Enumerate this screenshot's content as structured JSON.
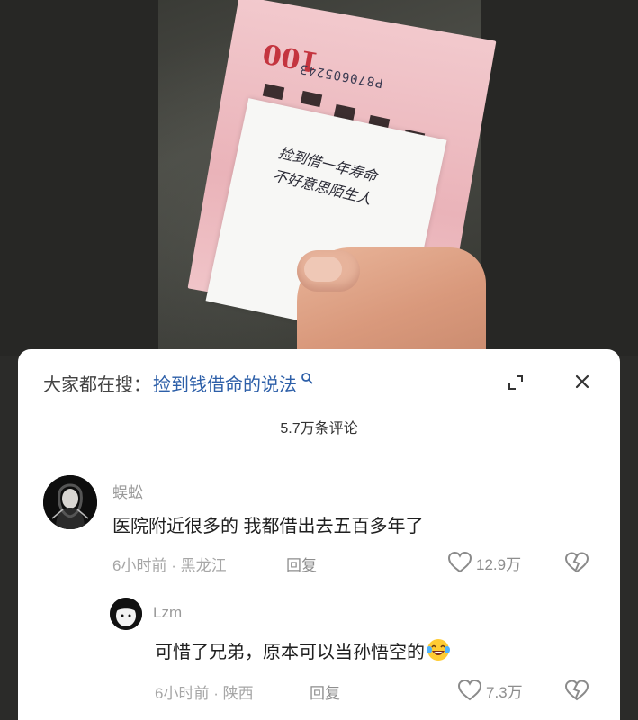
{
  "photo": {
    "serial": "P870605243",
    "denomination": "100",
    "note_line1": "捡到借一年寿命",
    "note_line2": "不好意思陌生人"
  },
  "search": {
    "prefix": "大家都在搜：",
    "query": "捡到钱借命的说法"
  },
  "comment_count": "5.7万条评论",
  "comments": [
    {
      "author": "蜈蚣",
      "text": "医院附近很多的 我都借出去五百多年了",
      "time": "6小时前",
      "location": "黑龙江",
      "reply_label": "回复",
      "likes": "12.9万"
    }
  ],
  "replies": [
    {
      "author": "Lzm",
      "text": "可惜了兄弟，原本可以当孙悟空的",
      "emoji": "laughing-crying-emoji",
      "time": "6小时前",
      "location": "陕西",
      "reply_label": "回复",
      "likes": "7.3万"
    }
  ],
  "colors": {
    "link_blue": "#2d5fa8",
    "meta_gray": "#a6a6a6",
    "sheet_bg": "#ffffff"
  }
}
